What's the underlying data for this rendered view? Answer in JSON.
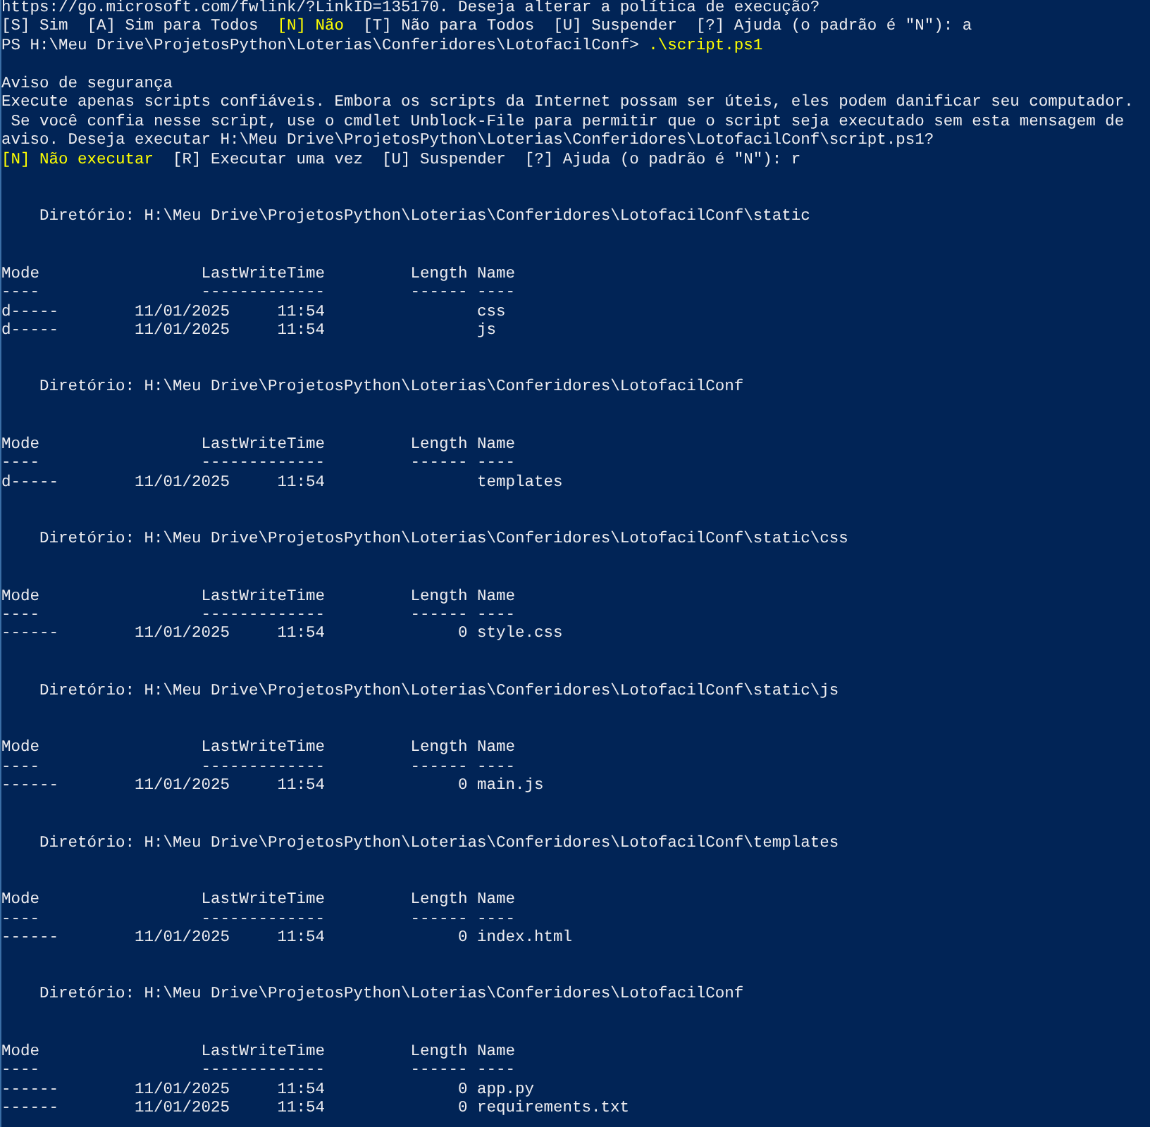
{
  "console": {
    "output": [
      {
        "kind": "text",
        "segments": [
          {
            "text": "https://go.microsoft.com/fwlink/?LinkID=135170. Deseja alterar a política de execução?",
            "highlight": false
          }
        ]
      },
      {
        "kind": "text",
        "segments": [
          {
            "text": "[S] Sim  [A] Sim para Todos  ",
            "highlight": false
          },
          {
            "text": "[N] Não",
            "highlight": true
          },
          {
            "text": "  [T] Não para Todos  [U] Suspender  [?] Ajuda (o padrão é \"N\"): a",
            "highlight": false
          }
        ]
      },
      {
        "kind": "text",
        "segments": [
          {
            "text": "PS H:\\Meu Drive\\ProjetosPython\\Loterias\\Conferidores\\LotofacilConf> ",
            "highlight": false
          },
          {
            "text": ".\\script.ps1",
            "highlight": true
          }
        ]
      },
      {
        "kind": "blank"
      },
      {
        "kind": "text",
        "segments": [
          {
            "text": "Aviso de segurança",
            "highlight": false
          }
        ]
      },
      {
        "kind": "text",
        "segments": [
          {
            "text": "Execute apenas scripts confiáveis. Embora os scripts da Internet possam ser úteis, eles podem danificar seu computador.",
            "highlight": false
          }
        ]
      },
      {
        "kind": "text",
        "segments": [
          {
            "text": " Se você confia nesse script, use o cmdlet Unblock-File para permitir que o script seja executado sem esta mensagem de",
            "highlight": false
          }
        ]
      },
      {
        "kind": "text",
        "segments": [
          {
            "text": "aviso. Deseja executar H:\\Meu Drive\\ProjetosPython\\Loterias\\Conferidores\\LotofacilConf\\script.ps1?",
            "highlight": false
          }
        ]
      },
      {
        "kind": "text",
        "segments": [
          {
            "text": "[N] Não executar",
            "highlight": true
          },
          {
            "text": "  [R] Executar uma vez  [U] Suspender  [?] Ajuda (o padrão é \"N\"): r",
            "highlight": false
          }
        ]
      },
      {
        "kind": "blank"
      },
      {
        "kind": "blank"
      },
      {
        "kind": "listing",
        "heading": "Diretório: H:\\Meu Drive\\ProjetosPython\\Loterias\\Conferidores\\LotofacilConf\\static",
        "columns": [
          "Mode",
          "LastWriteTime",
          "Length",
          "Name"
        ],
        "rules": [
          "----",
          "-------------",
          "------",
          "----"
        ],
        "entries": [
          {
            "mode": "d-----",
            "date": "11/01/2025",
            "time": "11:54",
            "name": "css"
          },
          {
            "mode": "d-----",
            "date": "11/01/2025",
            "time": "11:54",
            "name": "js"
          }
        ]
      },
      {
        "kind": "blank"
      },
      {
        "kind": "blank"
      },
      {
        "kind": "listing",
        "heading": "Diretório: H:\\Meu Drive\\ProjetosPython\\Loterias\\Conferidores\\LotofacilConf",
        "columns": [
          "Mode",
          "LastWriteTime",
          "Length",
          "Name"
        ],
        "rules": [
          "----",
          "-------------",
          "------",
          "----"
        ],
        "entries": [
          {
            "mode": "d-----",
            "date": "11/01/2025",
            "time": "11:54",
            "name": "templates"
          }
        ]
      },
      {
        "kind": "blank"
      },
      {
        "kind": "blank"
      },
      {
        "kind": "listing",
        "heading": "Diretório: H:\\Meu Drive\\ProjetosPython\\Loterias\\Conferidores\\LotofacilConf\\static\\css",
        "columns": [
          "Mode",
          "LastWriteTime",
          "Length",
          "Name"
        ],
        "rules": [
          "----",
          "-------------",
          "------",
          "----"
        ],
        "entries": [
          {
            "mode": "------",
            "date": "11/01/2025",
            "time": "11:54",
            "length": "0",
            "name": "style.css"
          }
        ]
      },
      {
        "kind": "blank"
      },
      {
        "kind": "blank"
      },
      {
        "kind": "listing",
        "heading": "Diretório: H:\\Meu Drive\\ProjetosPython\\Loterias\\Conferidores\\LotofacilConf\\static\\js",
        "columns": [
          "Mode",
          "LastWriteTime",
          "Length",
          "Name"
        ],
        "rules": [
          "----",
          "-------------",
          "------",
          "----"
        ],
        "entries": [
          {
            "mode": "------",
            "date": "11/01/2025",
            "time": "11:54",
            "length": "0",
            "name": "main.js"
          }
        ]
      },
      {
        "kind": "blank"
      },
      {
        "kind": "blank"
      },
      {
        "kind": "listing",
        "heading": "Diretório: H:\\Meu Drive\\ProjetosPython\\Loterias\\Conferidores\\LotofacilConf\\templates",
        "columns": [
          "Mode",
          "LastWriteTime",
          "Length",
          "Name"
        ],
        "rules": [
          "----",
          "-------------",
          "------",
          "----"
        ],
        "entries": [
          {
            "mode": "------",
            "date": "11/01/2025",
            "time": "11:54",
            "length": "0",
            "name": "index.html"
          }
        ]
      },
      {
        "kind": "blank"
      },
      {
        "kind": "blank"
      },
      {
        "kind": "listing",
        "heading": "Diretório: H:\\Meu Drive\\ProjetosPython\\Loterias\\Conferidores\\LotofacilConf",
        "columns": [
          "Mode",
          "LastWriteTime",
          "Length",
          "Name"
        ],
        "rules": [
          "----",
          "-------------",
          "------",
          "----"
        ],
        "entries": [
          {
            "mode": "------",
            "date": "11/01/2025",
            "time": "11:54",
            "length": "0",
            "name": "app.py"
          },
          {
            "mode": "------",
            "date": "11/01/2025",
            "time": "11:54",
            "length": "0",
            "name": "requirements.txt"
          }
        ]
      }
    ]
  }
}
